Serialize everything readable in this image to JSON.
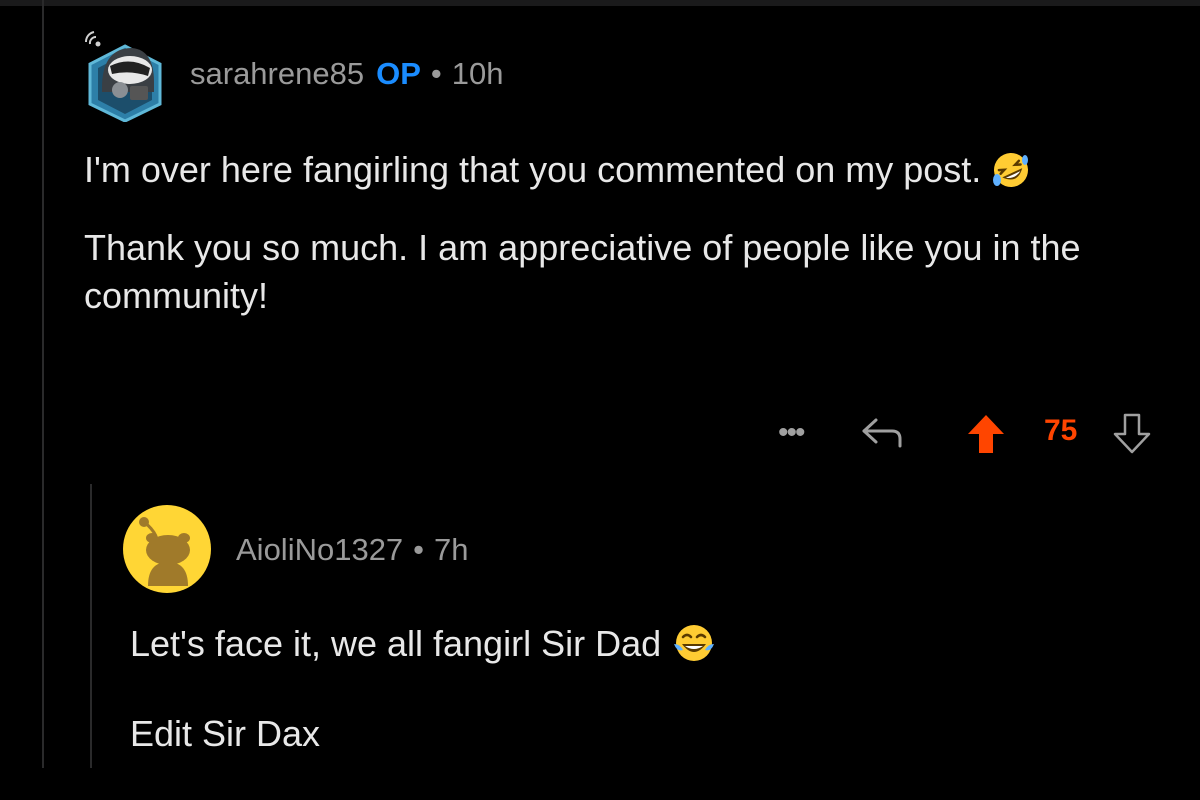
{
  "comment": {
    "username": "sarahrene85",
    "op_badge": "OP",
    "separator": "•",
    "time": "10h",
    "paragraph1": "I'm over here fangirling that you commented on my post.",
    "paragraph2": "Thank you so much. I am appreciative of people like you in the community!",
    "actions": {
      "more": "•••",
      "vote_count": "75"
    }
  },
  "reply": {
    "username": "AioliNo1327",
    "separator": "•",
    "time": "7h",
    "paragraph1": "Let's face it, we all fangirl Sir Dad",
    "paragraph2": "Edit Sir Dax"
  },
  "icons": {
    "avatar_op": "robot-avatar-icon",
    "avatar_reply": "snoo-avatar-icon",
    "emoji_1": "rolling-on-floor-laughing-emoji",
    "emoji_2": "tears-of-joy-emoji",
    "more": "more-options-icon",
    "reply": "reply-arrow-icon",
    "upvote": "upvote-arrow-icon",
    "downvote": "downvote-arrow-icon"
  },
  "colors": {
    "background": "#000000",
    "username": "#9a9a9a",
    "op_badge": "#1a8cff",
    "upvote": "#ff4500",
    "body_text": "#e8e8e8"
  }
}
